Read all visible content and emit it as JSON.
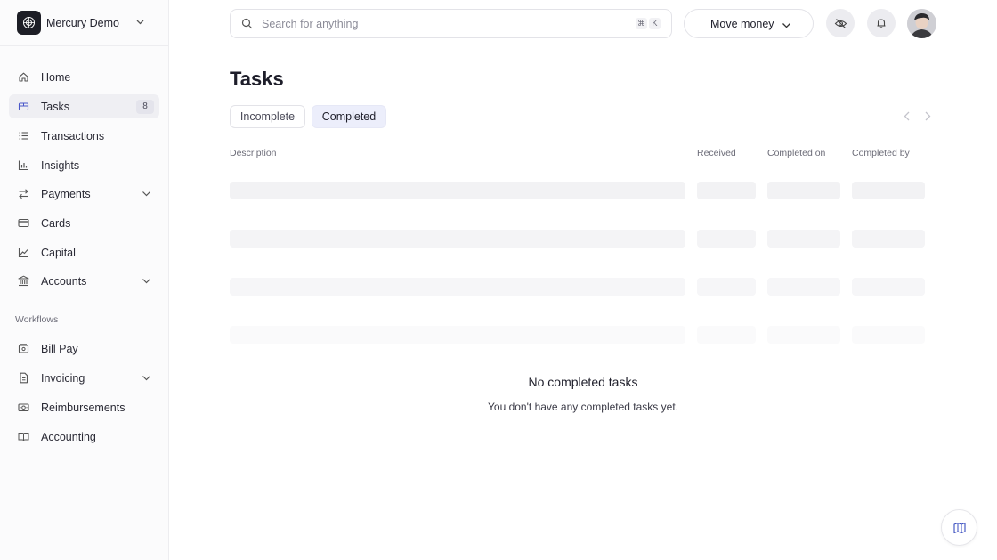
{
  "org": {
    "name": "Mercury Demo"
  },
  "sidebar": {
    "items": [
      {
        "label": "Home",
        "icon": "home-icon"
      },
      {
        "label": "Tasks",
        "icon": "tasks-icon",
        "badge": "8",
        "active": true
      },
      {
        "label": "Transactions",
        "icon": "list-icon"
      },
      {
        "label": "Insights",
        "icon": "bar-chart-icon"
      },
      {
        "label": "Payments",
        "icon": "transfer-arrows-icon",
        "expandable": true
      },
      {
        "label": "Cards",
        "icon": "card-icon"
      },
      {
        "label": "Capital",
        "icon": "line-chart-icon"
      },
      {
        "label": "Accounts",
        "icon": "bank-icon",
        "expandable": true
      }
    ],
    "section_label": "Workflows",
    "workflow_items": [
      {
        "label": "Bill Pay",
        "icon": "bill-icon"
      },
      {
        "label": "Invoicing",
        "icon": "invoice-icon",
        "expandable": true
      },
      {
        "label": "Reimbursements",
        "icon": "cash-icon"
      },
      {
        "label": "Accounting",
        "icon": "book-icon"
      }
    ]
  },
  "search": {
    "placeholder": "Search for anything",
    "shortcut_keys": [
      "⌘",
      "K"
    ]
  },
  "header": {
    "move_money_label": "Move money"
  },
  "page": {
    "title": "Tasks",
    "tabs": [
      {
        "label": "Incomplete",
        "selected": false
      },
      {
        "label": "Completed",
        "selected": true
      }
    ],
    "table": {
      "columns": [
        "Description",
        "Received",
        "Completed on",
        "Completed by"
      ]
    },
    "empty_state": {
      "title": "No completed tasks",
      "message": "You don't have any completed tasks yet."
    }
  },
  "colors": {
    "active_tab_bg": "#eceefb",
    "sidebar_bg": "#fbfbfc",
    "skeleton": "#f2f2f4"
  }
}
